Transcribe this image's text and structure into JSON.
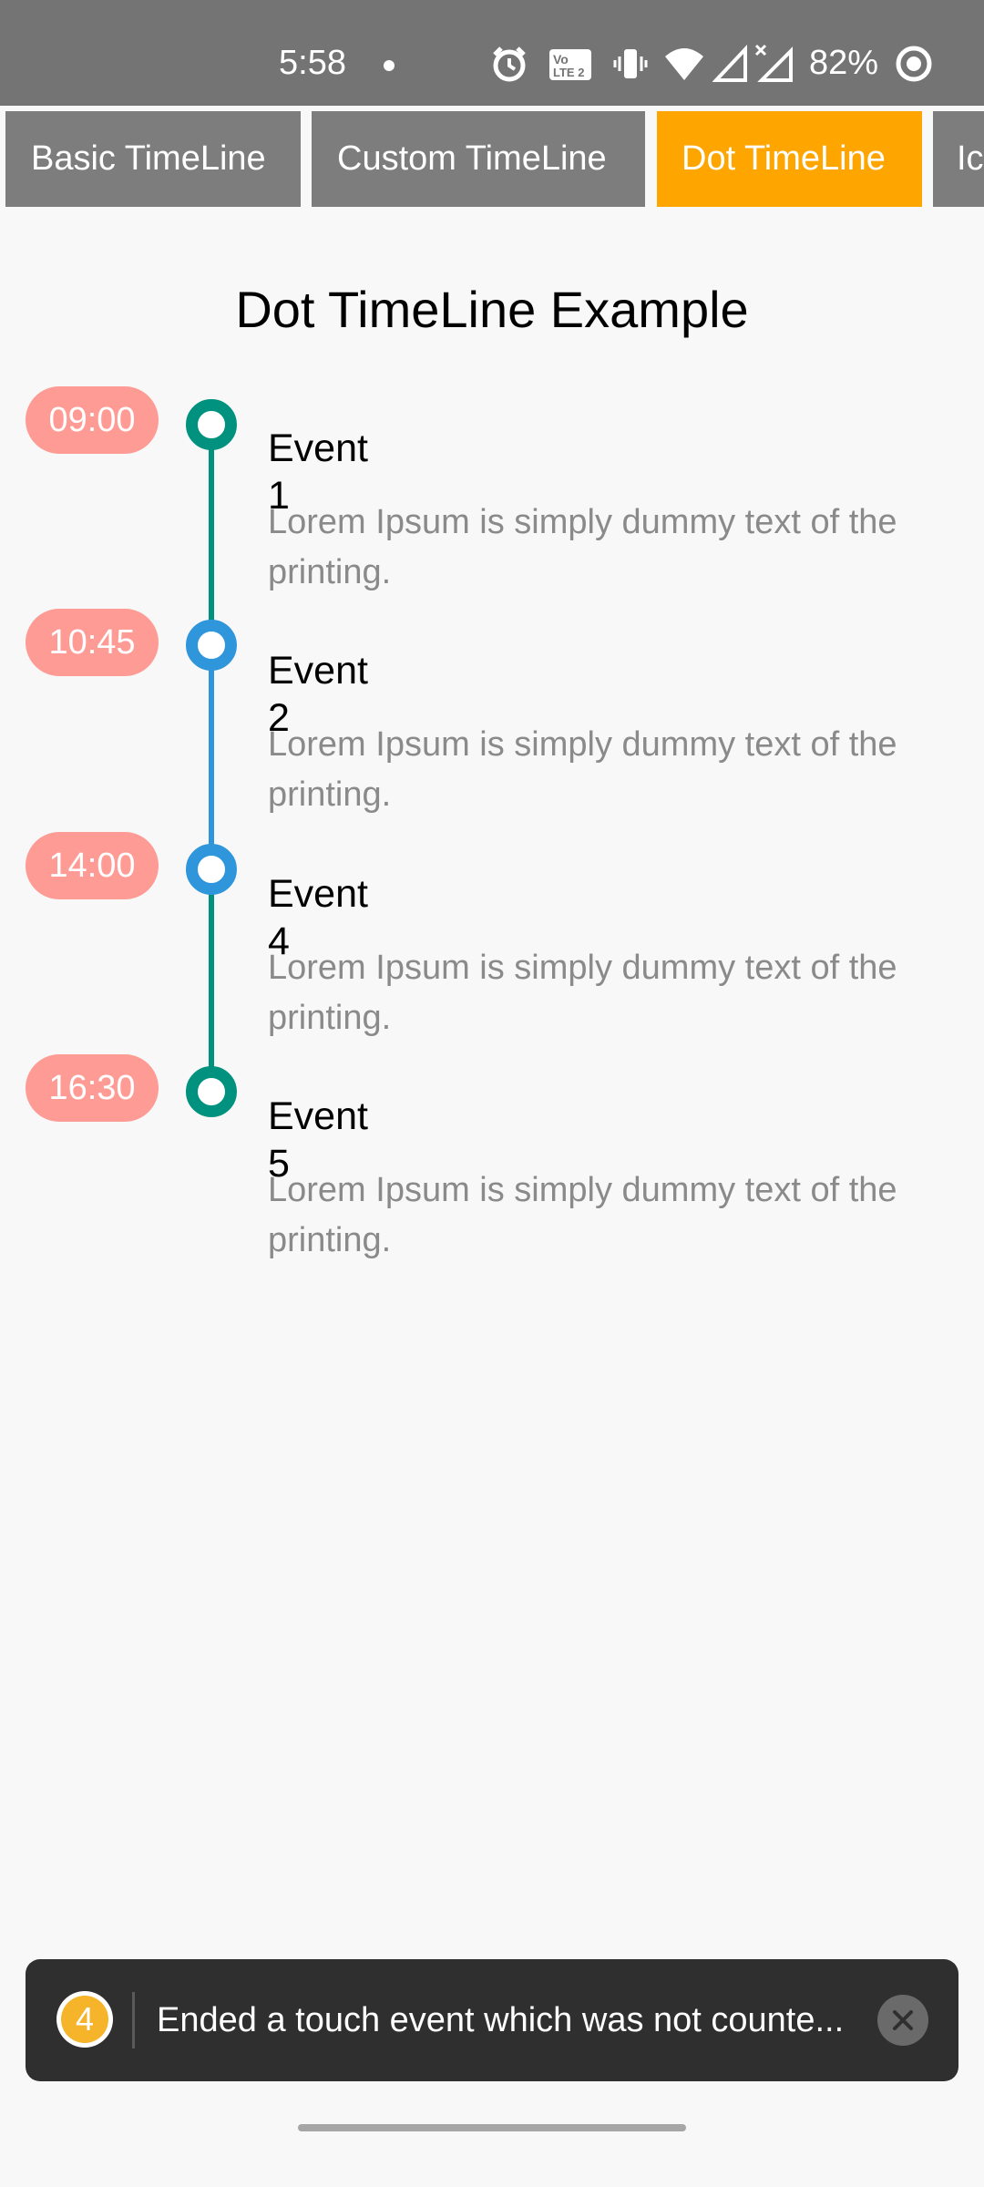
{
  "status_bar": {
    "time": "5:58",
    "battery": "82%",
    "volte_label": "Vo LTE 2",
    "icons": [
      "notification-dot",
      "alarm-icon",
      "volte-icon",
      "vibrate-icon",
      "wifi-icon",
      "signal-icon",
      "signal-x-icon",
      "battery-saver-icon"
    ]
  },
  "tabs": [
    {
      "label": "Basic TimeLine",
      "active": false
    },
    {
      "label": "Custom TimeLine",
      "active": false
    },
    {
      "label": "Dot TimeLine",
      "active": true
    },
    {
      "label": "Ic",
      "active": false
    }
  ],
  "title": "Dot TimeLine Example",
  "events": [
    {
      "time": "09:00",
      "title": "Event 1",
      "desc": "Lorem Ipsum is simply dummy text of the printing.",
      "dot_color": "#00917f"
    },
    {
      "time": "10:45",
      "title": "Event 2",
      "desc": "Lorem Ipsum is simply dummy text of the printing.",
      "dot_color": "#2f96dc"
    },
    {
      "time": "14:00",
      "title": "Event 4",
      "desc": "Lorem Ipsum is simply dummy text of the printing.",
      "dot_color": "#2f96dc"
    },
    {
      "time": "16:30",
      "title": "Event 5",
      "desc": "Lorem Ipsum is simply dummy text of the printing.",
      "dot_color": "#00917f"
    }
  ],
  "colors": {
    "tab_active": "#ffa500",
    "tab_inactive": "#7d7d7d",
    "time_pill": "#ff9b95",
    "line_teal": "#00917f",
    "line_blue": "#2f96dc"
  },
  "toast": {
    "badge": "4",
    "text": "Ended a touch event which was not counte...",
    "close_icon": "close-icon"
  }
}
